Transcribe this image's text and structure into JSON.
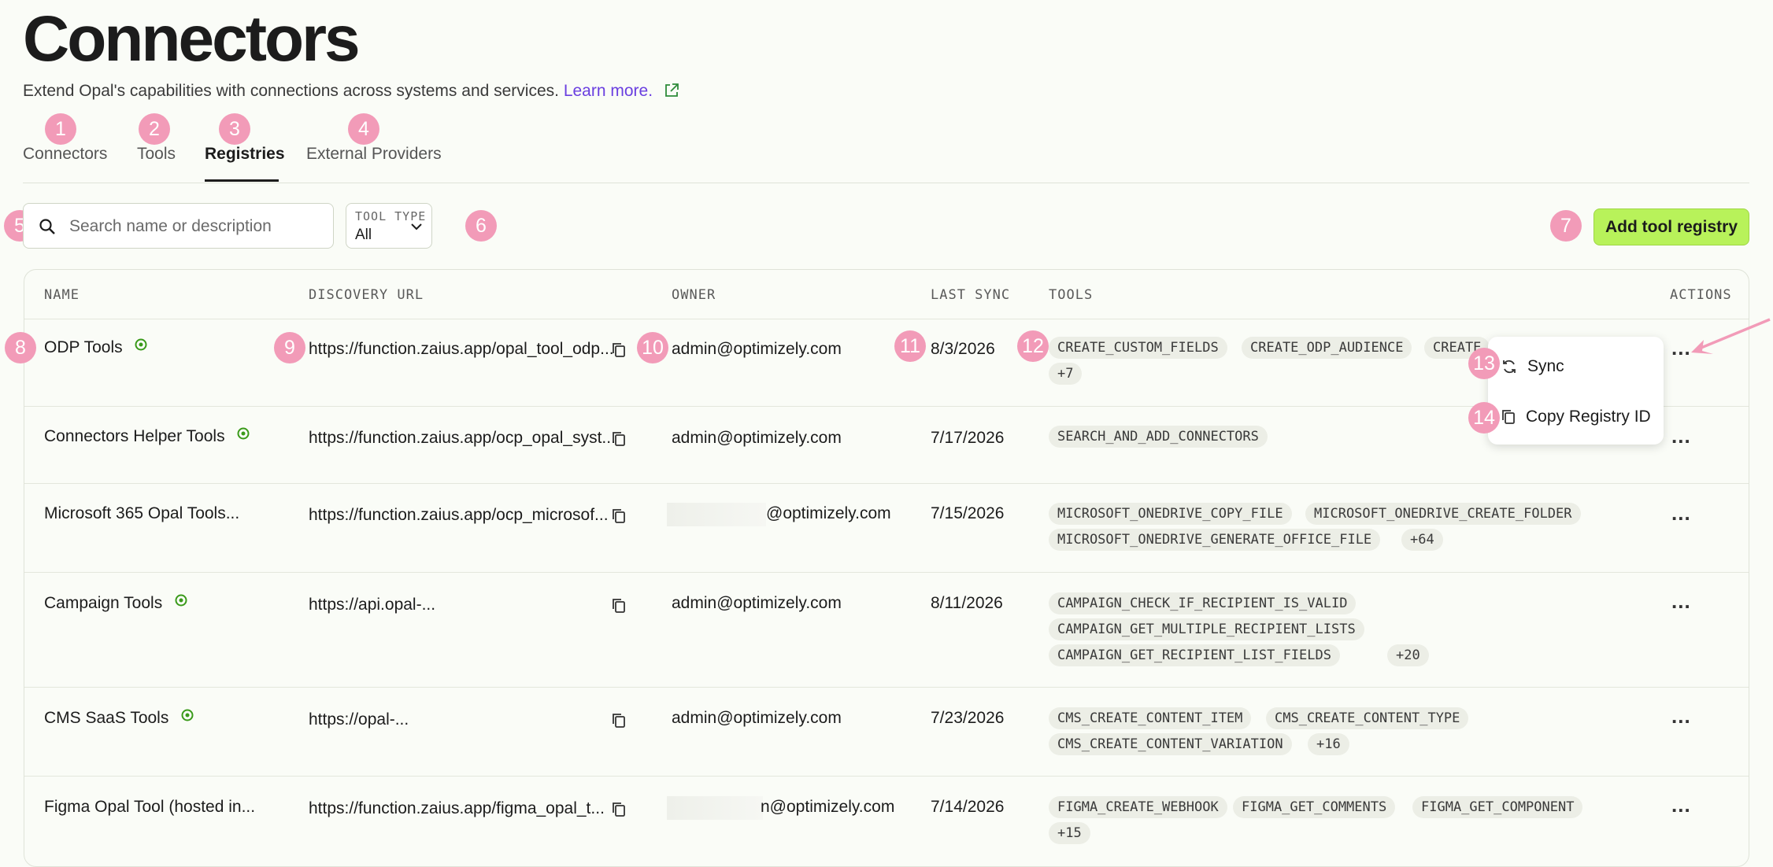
{
  "page": {
    "title": "Connectors",
    "subtitle": "Extend Opal's capabilities with connections across systems and services.",
    "learn_more": "Learn more."
  },
  "tabs": [
    {
      "label": "Connectors",
      "badge": "1"
    },
    {
      "label": "Tools",
      "badge": "2"
    },
    {
      "label": "Registries",
      "badge": "3"
    },
    {
      "label": "External Providers",
      "badge": "4"
    }
  ],
  "active_tab": "Registries",
  "search": {
    "placeholder": "Search name or description",
    "badge": "5"
  },
  "tool_type": {
    "label": "TOOL TYPE",
    "value": "All",
    "badge": "6"
  },
  "add_button": {
    "label": "Add tool registry",
    "badge": "7"
  },
  "table": {
    "columns": [
      "NAME",
      "DISCOVERY URL",
      "OWNER",
      "LAST SYNC",
      "TOOLS",
      "ACTIONS"
    ],
    "rows": [
      {
        "name": "ODP Tools",
        "active": true,
        "url": "https://function.zaius.app/opal_tool_odp...",
        "owner": "admin@optimizely.com",
        "last_sync": "8/3/2026",
        "tools": [
          "CREATE_CUSTOM_FIELDS",
          "CREATE_ODP_AUDIENCE",
          "CREATE",
          "+7"
        ]
      },
      {
        "name": "Connectors Helper Tools",
        "active": true,
        "url": "https://function.zaius.app/ocp_opal_syst...",
        "owner": "admin@optimizely.com",
        "last_sync": "7/17/2026",
        "tools": [
          "SEARCH_AND_ADD_CONNECTORS"
        ]
      },
      {
        "name": "Microsoft 365 Opal Tools...",
        "active": false,
        "url": "https://function.zaius.app/ocp_microsof...",
        "owner": "@optimizely.com",
        "last_sync": "7/15/2026",
        "tools": [
          "MICROSOFT_ONEDRIVE_COPY_FILE",
          "MICROSOFT_ONEDRIVE_CREATE_FOLDER",
          "MICROSOFT_ONEDRIVE_GENERATE_OFFICE_FILE",
          "+64"
        ]
      },
      {
        "name": "Campaign Tools",
        "active": true,
        "url": "https://api.opal-...",
        "owner": "admin@optimizely.com",
        "last_sync": "8/11/2026",
        "tools": [
          "CAMPAIGN_CHECK_IF_RECIPIENT_IS_VALID",
          "CAMPAIGN_GET_MULTIPLE_RECIPIENT_LISTS",
          "CAMPAIGN_GET_RECIPIENT_LIST_FIELDS",
          "+20"
        ]
      },
      {
        "name": "CMS SaaS Tools",
        "active": true,
        "url": "https://opal-...",
        "owner": "admin@optimizely.com",
        "last_sync": "7/23/2026",
        "tools": [
          "CMS_CREATE_CONTENT_ITEM",
          "CMS_CREATE_CONTENT_TYPE",
          "CMS_CREATE_CONTENT_VARIATION",
          "+16"
        ]
      },
      {
        "name": "Figma Opal Tool (hosted in...",
        "active": false,
        "url": "https://function.zaius.app/figma_opal_t...",
        "owner": "n@optimizely.com",
        "last_sync": "7/14/2026",
        "tools": [
          "FIGMA_CREATE_WEBHOOK",
          "FIGMA_GET_COMMENTS",
          "FIGMA_GET_COMPONENT",
          "+15"
        ]
      }
    ]
  },
  "row_badges": {
    "name": "8",
    "url": "9",
    "owner": "10",
    "sync": "11",
    "tools": "12"
  },
  "action_menu": {
    "items": [
      {
        "label": "Sync",
        "icon": "sync-icon",
        "badge": "13"
      },
      {
        "label": "Copy Registry ID",
        "icon": "copy-icon",
        "badge": "14"
      }
    ]
  },
  "more_label": "...",
  "colors": {
    "accent_button": "#b8f25a",
    "badge": "#f29bb8",
    "link": "#6a3fe0",
    "status": "#3a9a1a"
  }
}
